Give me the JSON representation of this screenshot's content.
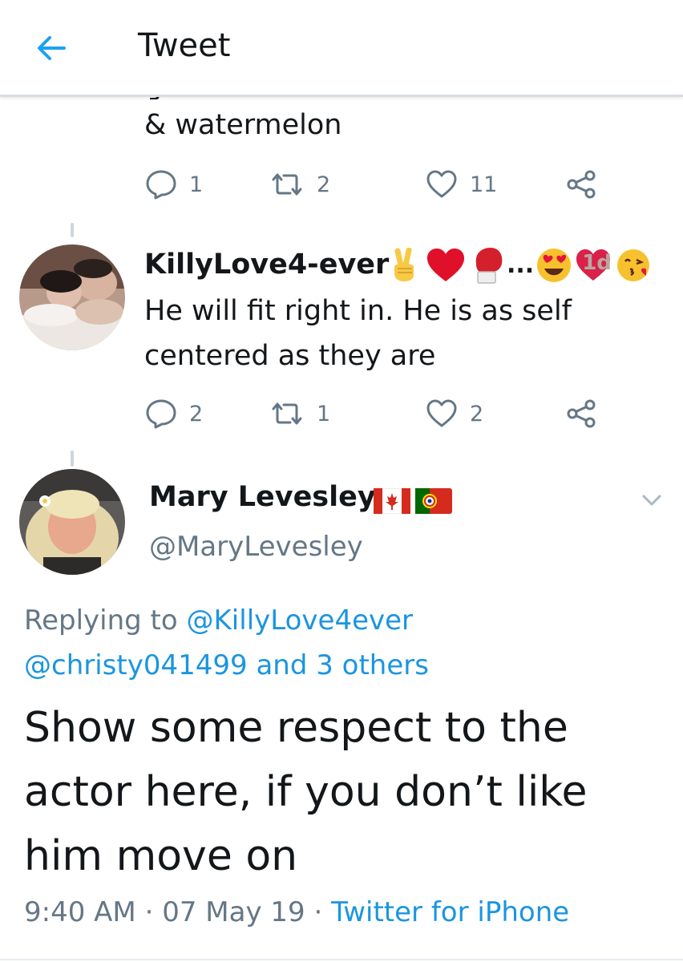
{
  "header": {
    "title": "Tweet",
    "back_icon": "back-arrow-icon",
    "accent": "#1da1f2"
  },
  "reply_top": {
    "text": "& watermelon",
    "counts": {
      "replies": "1",
      "retweets": "2",
      "likes": "11"
    }
  },
  "reply_killy": {
    "name": "KillyLove4-ever",
    "name_emojis": [
      "victory-hand-emoji",
      "red-heart-emoji",
      "boxing-glove-emoji",
      "ellipsis",
      "heart-eyes-emoji",
      "heart-with-1d-badge",
      "kissing-face-emoji"
    ],
    "ellipsis": "...",
    "badge": "1d",
    "text": "He will fit right in. He is as self centered as they are",
    "counts": {
      "replies": "2",
      "retweets": "1",
      "likes": "2"
    }
  },
  "main_tweet": {
    "name": "Mary Levesley",
    "flags": [
      "canada-flag",
      "portugal-flag"
    ],
    "handle": "@MaryLevesley",
    "replying_prefix": "Replying to",
    "replying_user1": "@KillyLove4ever",
    "replying_user2": "@christy041499",
    "replying_and": "and",
    "replying_others": "3 others",
    "text": "Show some respect to the actor here, if you don’t like him move on",
    "time": "9:40 AM",
    "separator": "·",
    "date": "07 May 19",
    "source": "Twitter for iPhone"
  },
  "colors": {
    "text": "#14171a",
    "secondary": "#657786",
    "link": "#1b95e0",
    "divider": "#e6ecf0"
  }
}
